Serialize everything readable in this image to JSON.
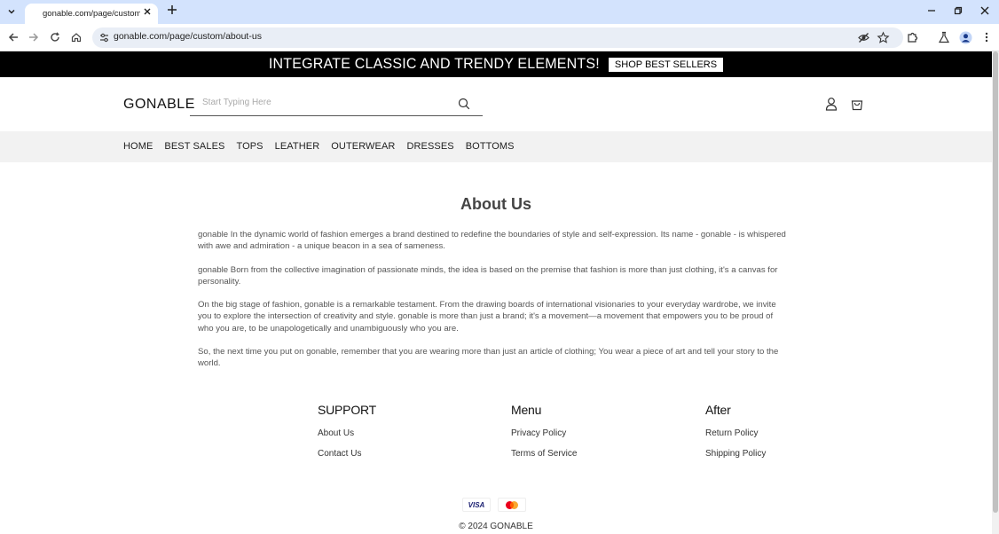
{
  "browser": {
    "tab_title": "gonable.com/page/custom/about-us",
    "url": "gonable.com/page/custom/about-us"
  },
  "promo": {
    "text": "INTEGRATE CLASSIC AND TRENDY ELEMENTS!",
    "button": "SHOP BEST SELLERS"
  },
  "header": {
    "logo": "GONABLE",
    "search_placeholder": "Start Typing Here"
  },
  "nav": {
    "items": [
      "HOME",
      "BEST SALES",
      "TOPS",
      "LEATHER",
      "OUTERWEAR",
      "DRESSES",
      "BOTTOMS"
    ]
  },
  "about": {
    "title": "About Us",
    "paragraphs": [
      "gonable In the dynamic world of fashion emerges a brand destined to redefine the boundaries of style and self-expression. Its name - gonable - is whispered with awe and admiration - a unique beacon in a sea of sameness.",
      "gonable Born from the collective imagination of passionate minds, the idea is based on the premise that fashion is more than just clothing, it's a canvas for personality.",
      "On the big stage of fashion, gonable is a remarkable testament. From the drawing boards of international visionaries to your everyday wardrobe, we invite you to explore the intersection of creativity and style. gonable is more than just a brand; it's a movement—a movement that empowers you to be proud of who you are, to be unapologetically and unambiguously who you are.",
      "So, the next time you put on gonable, remember that you are wearing more than just an article of clothing; You wear a piece of art and tell your story to the world."
    ]
  },
  "footer": {
    "columns": [
      {
        "title": "SUPPORT",
        "links": [
          "About Us",
          "Contact Us"
        ]
      },
      {
        "title": "Menu",
        "links": [
          "Privacy Policy",
          "Terms of Service"
        ]
      },
      {
        "title": "After",
        "links": [
          "Return Policy",
          "Shipping Policy"
        ]
      }
    ],
    "payments": {
      "visa": "VISA",
      "mastercard_icon": "mastercard-icon"
    },
    "copyright": "© 2024 GONABLE"
  },
  "icons": {
    "tab_list": "chevron-down-icon",
    "close_tab": "close-icon",
    "new_tab": "plus-icon",
    "back": "back-arrow-icon",
    "forward": "forward-arrow-icon",
    "reload": "reload-icon",
    "home": "home-icon",
    "site_info": "tune-icon",
    "eye_off": "eye-off-icon",
    "bookmark": "star-icon",
    "extensions": "puzzle-icon",
    "labs": "flask-icon",
    "profile": "profile-icon",
    "menu": "kebab-menu-icon",
    "search": "search-icon",
    "account": "user-icon",
    "cart": "shopping-bag-icon"
  },
  "colors": {
    "chrome_tab_bar": "#d3e3fd",
    "promo_bg": "#000000",
    "nav_bg": "#f2f2f2"
  }
}
